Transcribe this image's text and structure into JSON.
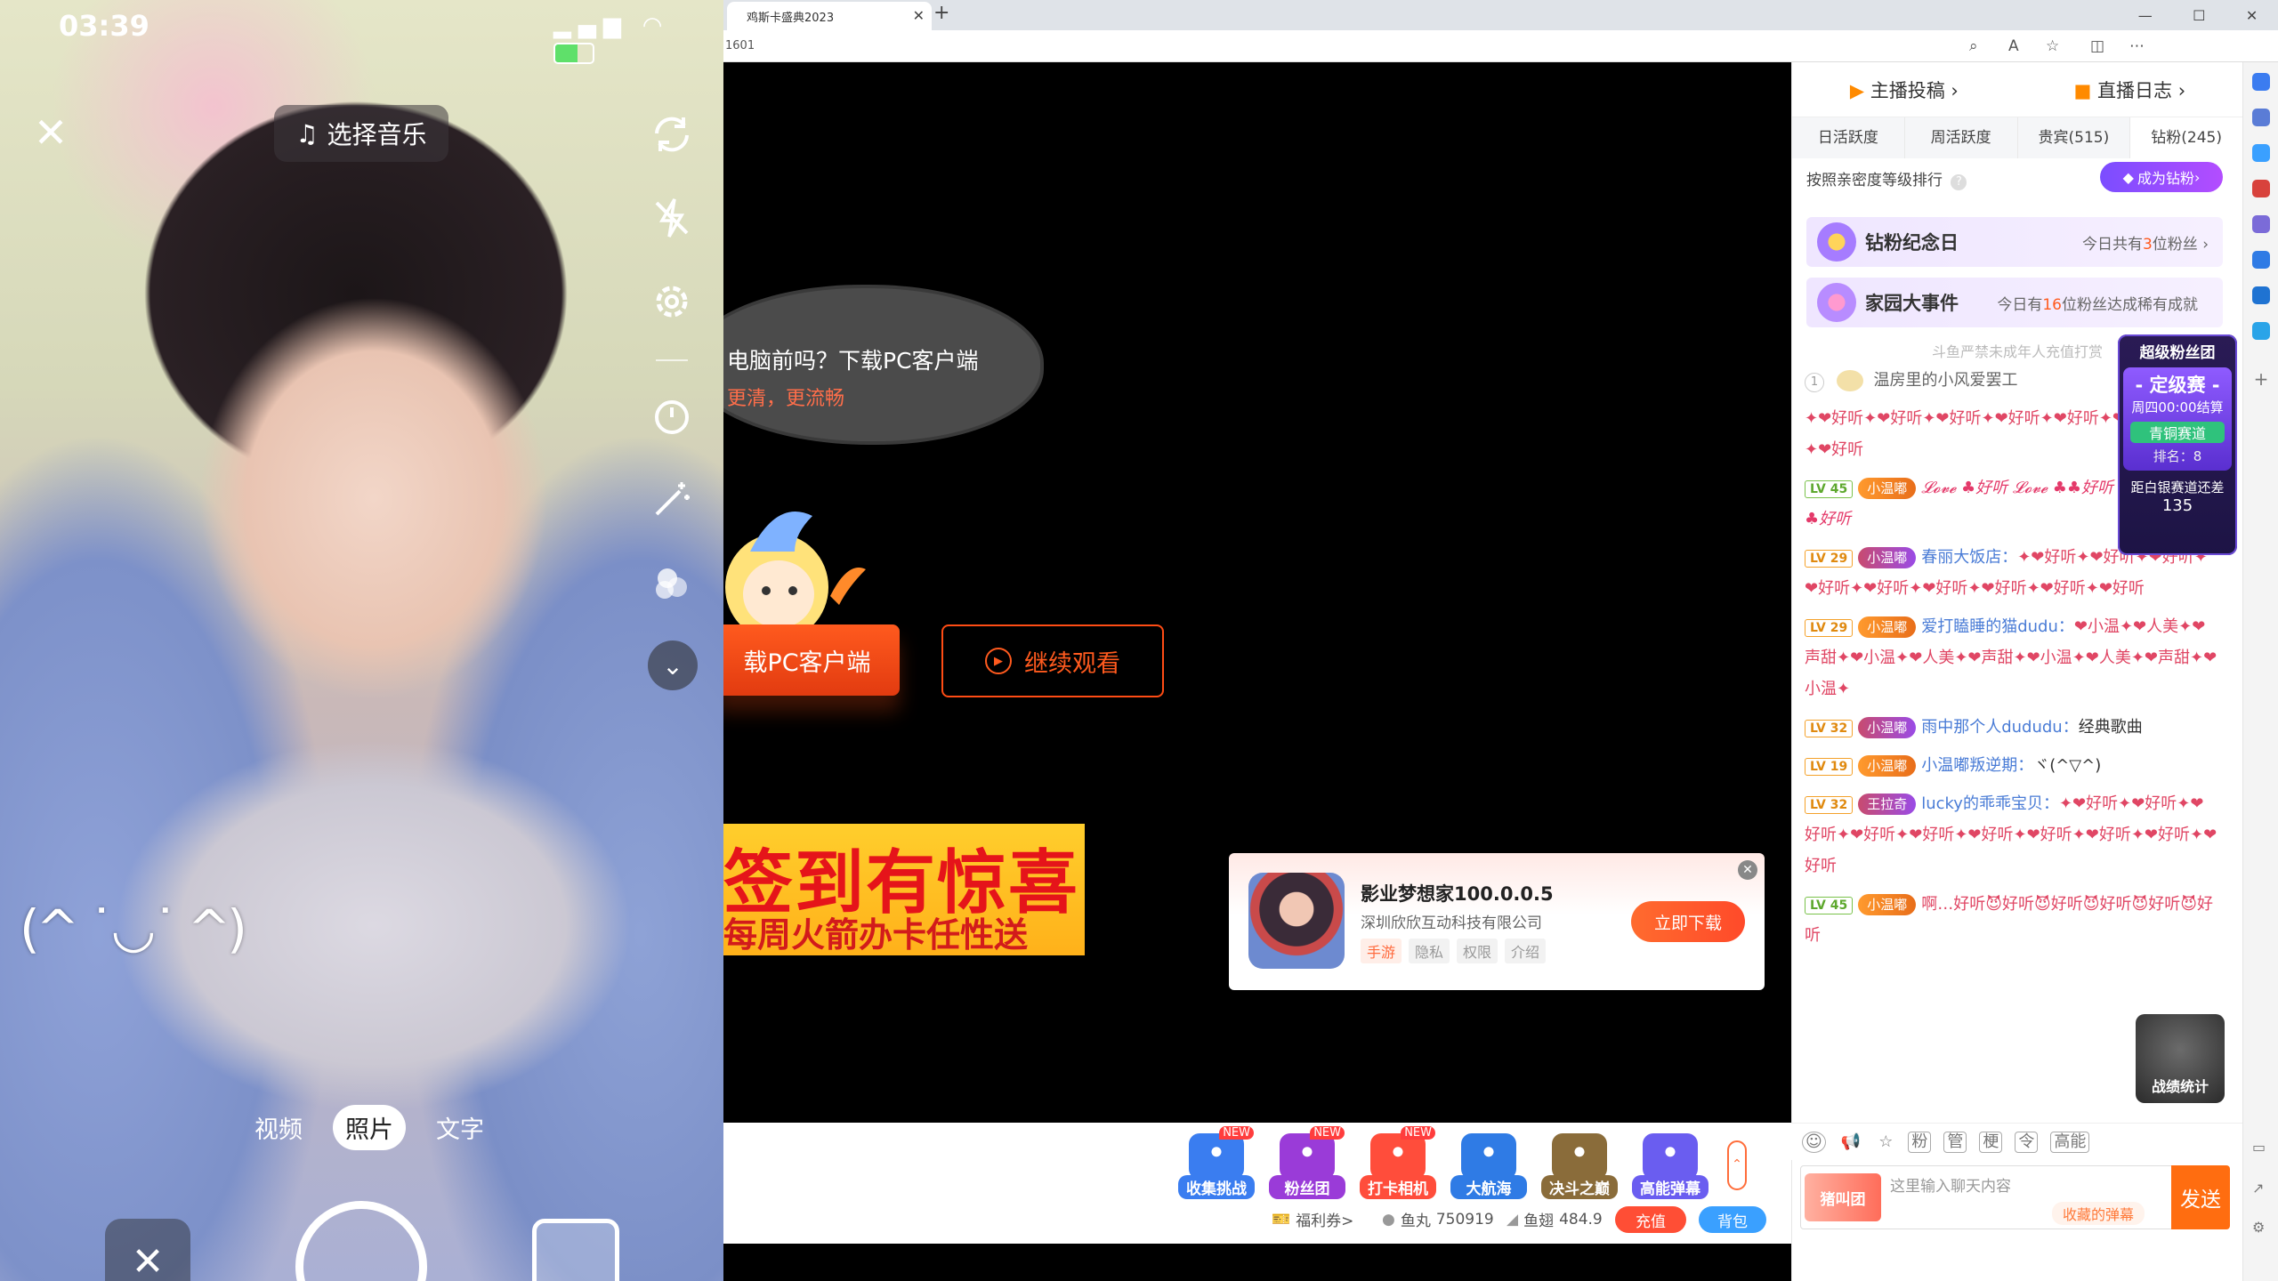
{
  "phone": {
    "time": "03:39",
    "music_label": "选择音乐",
    "modes": [
      "视频",
      "照片",
      "文字"
    ],
    "kaomoji": "(^ ˙◡˙ ^)"
  },
  "browser": {
    "tab_title": "鸡斯卡盛典2023",
    "url": "1601"
  },
  "video": {
    "bubble_line1": "电脑前吗？下载PC客户端",
    "bubble_line2": "更清，更流畅",
    "download_btn": "载PC客户端",
    "watch_btn": "继续观看",
    "banner_line1": "签到有惊喜",
    "banner_line2": "每周火箭办卡任性送"
  },
  "ad": {
    "title": "影业梦想家100.0.0.5",
    "company": "深圳欣欣互动科技有限公司",
    "tags": [
      "手游",
      "隐私",
      "权限",
      "介绍"
    ],
    "button": "立即下载"
  },
  "gifts": [
    {
      "label": "收集挑战",
      "new": "NEW",
      "color": "#3a7df0"
    },
    {
      "label": "粉丝团",
      "new": "NEW",
      "color": "#9a3bd8"
    },
    {
      "label": "打卡相机",
      "new": "NEW",
      "color": "#ff4d3b"
    },
    {
      "label": "大航海",
      "new": "",
      "color": "#2f7be5"
    },
    {
      "label": "决斗之巅",
      "new": "",
      "color": "#8a6c3a"
    },
    {
      "label": "高能弹幕",
      "new": "",
      "color": "#6a5df0"
    }
  ],
  "wallet": {
    "welfare": "福利券>",
    "yuwan_label": "鱼丸",
    "yuwan_value": "750919",
    "yuchi_label": "鱼翅",
    "yuchi_value": "484.9",
    "recharge": "充值",
    "bag": "背包"
  },
  "panel": {
    "top_left": "主播投稿",
    "top_right": "直播日志",
    "rank_tabs": [
      "日活跃度",
      "周活跃度",
      "贵宾(515)",
      "钻粉(245)"
    ],
    "rank_note": "按照亲密度等级排行",
    "be_diamond": "成为钻粉",
    "promo1_title": "钻粉纪念日",
    "promo1_sub_a": "今日共有",
    "promo1_sub_n": "3",
    "promo1_sub_b": "位粉丝",
    "promo2_title": "家园大事件",
    "promo2_sub_a": "今日有",
    "promo2_sub_n": "16",
    "promo2_sub_b": "位粉丝达成稀有成就",
    "notice": "斗鱼严禁未成年人充值打赏"
  },
  "chat": {
    "first_name": "温房里的小风爱罢工",
    "first_rank": "1",
    "msgs": [
      {
        "lv": "",
        "badge": "",
        "nick": "",
        "text": "✦❤好听✦❤好听✦❤好听✦❤好听✦❤好听✦❤好听✦❤好听✦❤好听"
      },
      {
        "lv": "LV 45",
        "badge": "小温嘟",
        "nick": "",
        "text": "𝓛𝓸𝓿𝓮 ♣好听 𝓛𝓸𝓿𝓮 ♣♣好听 𝓛𝓸𝓿𝓮 ♣ 𝓛𝓸𝓿𝓮 ♣好听"
      },
      {
        "lv": "LV 29",
        "badge": "小温嘟",
        "nick": "春丽大饭店：",
        "text": "✦❤好听✦❤好听✦❤好听✦❤好听✦❤好听✦❤好听✦❤好听✦❤好听✦❤好听"
      },
      {
        "lv": "LV 29",
        "badge": "小温嘟",
        "nick": "爱打瞌睡的猫dudu：",
        "text": "❤小温✦❤人美✦❤声甜✦❤小温✦❤人美✦❤声甜✦❤小温✦❤人美✦❤声甜✦❤小温✦"
      },
      {
        "lv": "LV 32",
        "badge": "小温嘟",
        "nick": "雨中那个人dududu：",
        "text": "经典歌曲"
      },
      {
        "lv": "LV 19",
        "badge": "小温嘟",
        "nick": "小温嘟叛逆期：",
        "text": "ヾ(^▽^)"
      },
      {
        "lv": "LV 32",
        "badge": "王拉奇",
        "nick": "lucky的乖乖宝贝：",
        "text": "✦❤好听✦❤好听✦❤好听✦❤好听✦❤好听✦❤好听✦❤好听✦❤好听✦❤好听✦❤好听"
      },
      {
        "lv": "LV 45",
        "badge": "小温嘟",
        "nick": "",
        "text": "啊…好听😈好听😈好听😈好听😈好听😈好听"
      }
    ]
  },
  "super_fan": {
    "title": "超级粉丝团",
    "stage": "- 定级赛 -",
    "time": "周四00:00结算",
    "track": "青铜赛道",
    "rank": "排名：8",
    "gap_label": "距白银赛道还差",
    "gap_value": "135"
  },
  "stat_badge": "战绩统计",
  "chat_tools": [
    "粉",
    "管",
    "梗",
    "令",
    "高能"
  ],
  "input": {
    "hype": "猪叫团",
    "placeholder": "这里输入聊天内容",
    "fav": "收藏的弹幕",
    "send": "发送"
  }
}
